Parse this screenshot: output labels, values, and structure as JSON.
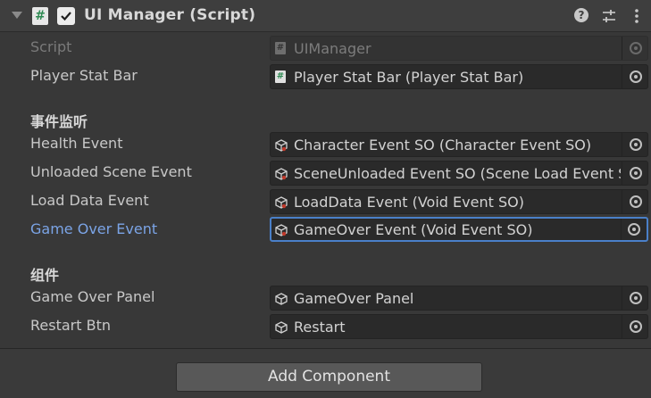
{
  "header": {
    "title": "UI Manager (Script)",
    "icons": [
      "fold-arrow-icon",
      "script-icon",
      "checkbox-checked-icon",
      "help-icon",
      "preset-icon",
      "menu-kebab-icon"
    ]
  },
  "fields": {
    "script": {
      "label": "Script",
      "value": "UIManager"
    },
    "player_stat_bar": {
      "label": "Player Stat Bar",
      "value": "Player Stat Bar (Player Stat Bar)"
    }
  },
  "sections": {
    "events": "事件监听",
    "components": "组件"
  },
  "events": {
    "health": {
      "label": "Health Event",
      "value": "Character Event SO (Character Event SO)"
    },
    "unloaded_scene": {
      "label": "Unloaded Scene Event",
      "value": "SceneUnloaded Event SO (Scene Load Event SO)"
    },
    "load_data": {
      "label": "Load Data Event",
      "value": "LoadData Event (Void Event SO)"
    },
    "game_over": {
      "label": "Game Over Event",
      "value": "GameOver Event (Void Event SO)"
    }
  },
  "components": {
    "game_over_panel": {
      "label": "Game Over Panel",
      "value": "GameOver Panel"
    },
    "restart_btn": {
      "label": "Restart Btn",
      "value": "Restart"
    }
  },
  "footer": {
    "add_component_label": "Add Component"
  },
  "colors": {
    "background": "#383838",
    "focus_border": "#4a80c9",
    "active_label": "#7ba4e6",
    "script_icon_green": "#2d8a52"
  }
}
